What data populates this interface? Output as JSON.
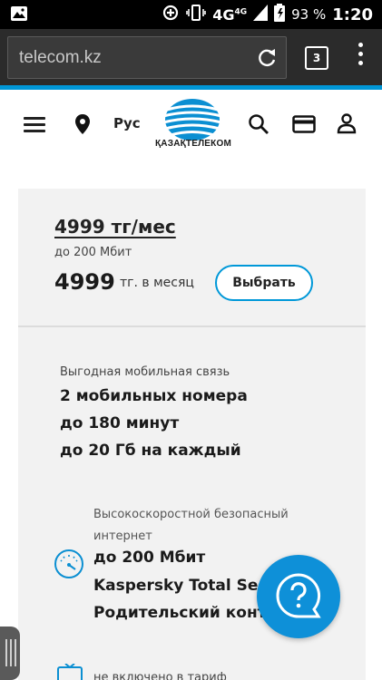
{
  "statusbar": {
    "network": "4G",
    "network_sup": "4G",
    "battery": "93 %",
    "time": "1:20",
    "icons": [
      "gallery-icon",
      "data-saver-icon",
      "vibrate-icon",
      "signal-icon",
      "battery-icon"
    ]
  },
  "browser": {
    "url": "telecom.kz",
    "tab_count": "3",
    "icons": [
      "reload-icon",
      "tabs-icon",
      "overflow-menu-icon"
    ]
  },
  "header": {
    "lang": "Рус",
    "logo_text": "ҚАЗАҚТЕЛЕКОМ",
    "icons": [
      "hamburger-icon",
      "location-pin-icon",
      "search-icon",
      "payment-card-icon",
      "user-icon"
    ],
    "accent": "#0096d6"
  },
  "tariff": {
    "name": "4999 тг/мес",
    "speed": "до 200 Мбит",
    "price": "4999",
    "price_unit": "тг. в месяц",
    "choose_label": "Выбрать",
    "mobile": {
      "title": "Выгодная мобильная связь",
      "lines": [
        "2 мобильных номера",
        "до 180 минут",
        "до 20 Гб на каждый"
      ]
    },
    "internet": {
      "title": "Высокоскоростной безопасный интернет",
      "lines": [
        "до 200 Мбит",
        "Kaspersky Total Security",
        "Родительский контроль"
      ]
    },
    "not_included": "не включено в тариф"
  },
  "help_button": {
    "icon": "help-question-icon",
    "color": "#0e90d8"
  }
}
